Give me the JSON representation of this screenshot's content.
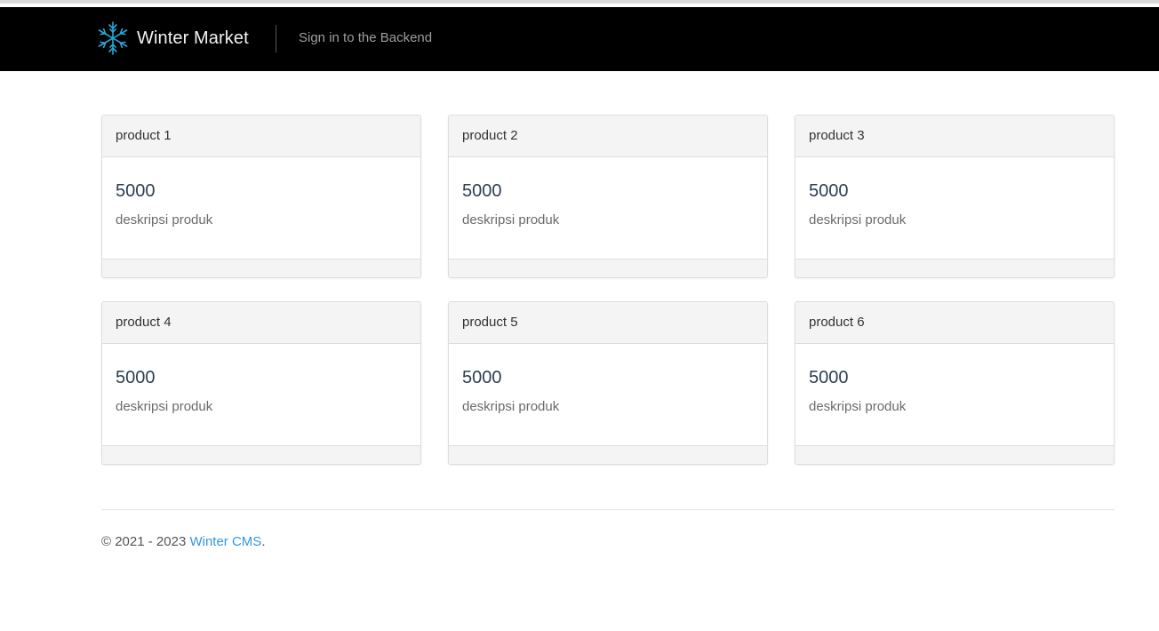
{
  "header": {
    "brand_name": "Winter Market",
    "brand_icon": "snowflake-icon",
    "nav_link": "Sign in to the Backend"
  },
  "products": [
    {
      "name": "product 1",
      "price": "5000",
      "description": "deskripsi produk"
    },
    {
      "name": "product 2",
      "price": "5000",
      "description": "deskripsi produk"
    },
    {
      "name": "product 3",
      "price": "5000",
      "description": "deskripsi produk"
    },
    {
      "name": "product 4",
      "price": "5000",
      "description": "deskripsi produk"
    },
    {
      "name": "product 5",
      "price": "5000",
      "description": "deskripsi produk"
    },
    {
      "name": "product 6",
      "price": "5000",
      "description": "deskripsi produk"
    }
  ],
  "footer": {
    "copyright": "© 2021 - 2023 ",
    "link_label": "Winter CMS",
    "suffix": "."
  },
  "colors": {
    "navbar": "#000000",
    "accent_link": "#3498db",
    "logo": "#2aa7d6"
  }
}
